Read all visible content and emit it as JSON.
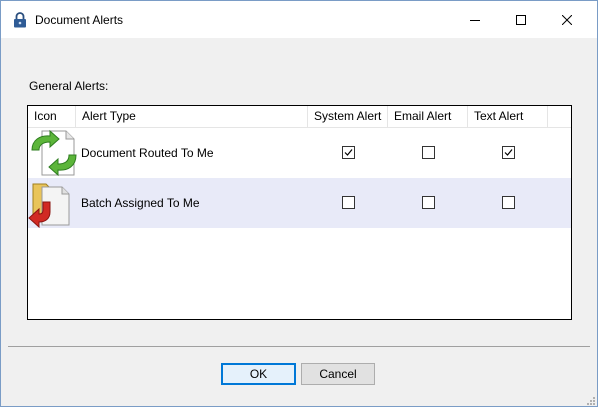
{
  "window": {
    "title": "Document Alerts",
    "icons": {
      "app": "padlock-icon",
      "minimize": "minimize-icon",
      "maximize": "maximize-icon",
      "close": "close-icon"
    }
  },
  "general_alerts_label": "General Alerts:",
  "columns": [
    "Icon",
    "Alert Type",
    "System Alert",
    "Email Alert",
    "Text Alert"
  ],
  "rows": [
    {
      "icon": "document-routed-icon",
      "type": "Document Routed To Me",
      "system": true,
      "email": false,
      "text": true
    },
    {
      "icon": "batch-assigned-icon",
      "type": "Batch Assigned To Me",
      "system": false,
      "email": false,
      "text": false
    }
  ],
  "buttons": {
    "ok": "OK",
    "cancel": "Cancel"
  },
  "colors": {
    "alt_row": "#e8eaf8",
    "default_button_border": "#0078d7"
  }
}
